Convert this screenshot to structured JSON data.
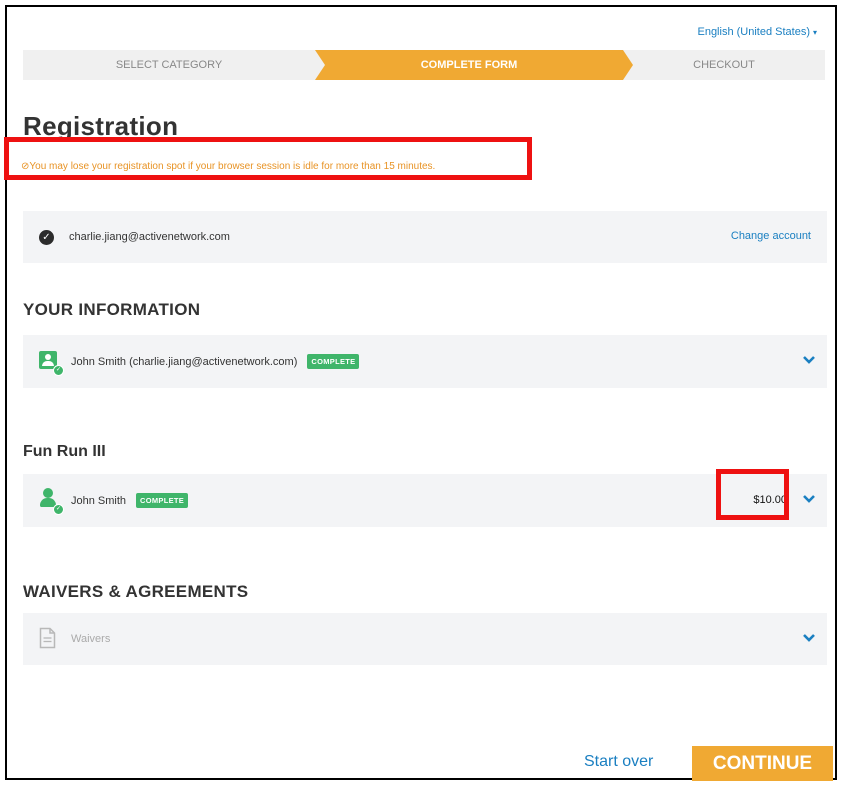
{
  "language": {
    "label": "English (United States)",
    "caret": "▾"
  },
  "steps": [
    {
      "label": "SELECT CATEGORY"
    },
    {
      "label": "COMPLETE FORM"
    },
    {
      "label": "CHECKOUT"
    }
  ],
  "page_title": "Registration",
  "warning": {
    "icon": "⊘",
    "text": "You may lose your registration spot if your browser session is idle for more than 15 minutes."
  },
  "account": {
    "email": "charlie.jiang@activenetwork.com",
    "change_label": "Change account"
  },
  "your_information": {
    "heading": "YOUR INFORMATION",
    "entry": "John Smith (charlie.jiang@activenetwork.com)",
    "badge": "COMPLETE"
  },
  "fun_run": {
    "heading": "Fun Run III",
    "entry": "John Smith",
    "badge": "COMPLETE",
    "price": "$10.00"
  },
  "waivers": {
    "heading": "WAIVERS & AGREEMENTS",
    "label": "Waivers"
  },
  "footer": {
    "start_over": "Start over",
    "continue": "CONTINUE"
  },
  "colors": {
    "accent": "#f0a933",
    "link": "#1a7fc1",
    "success": "#3fb56a",
    "highlight": "#ee1111"
  }
}
